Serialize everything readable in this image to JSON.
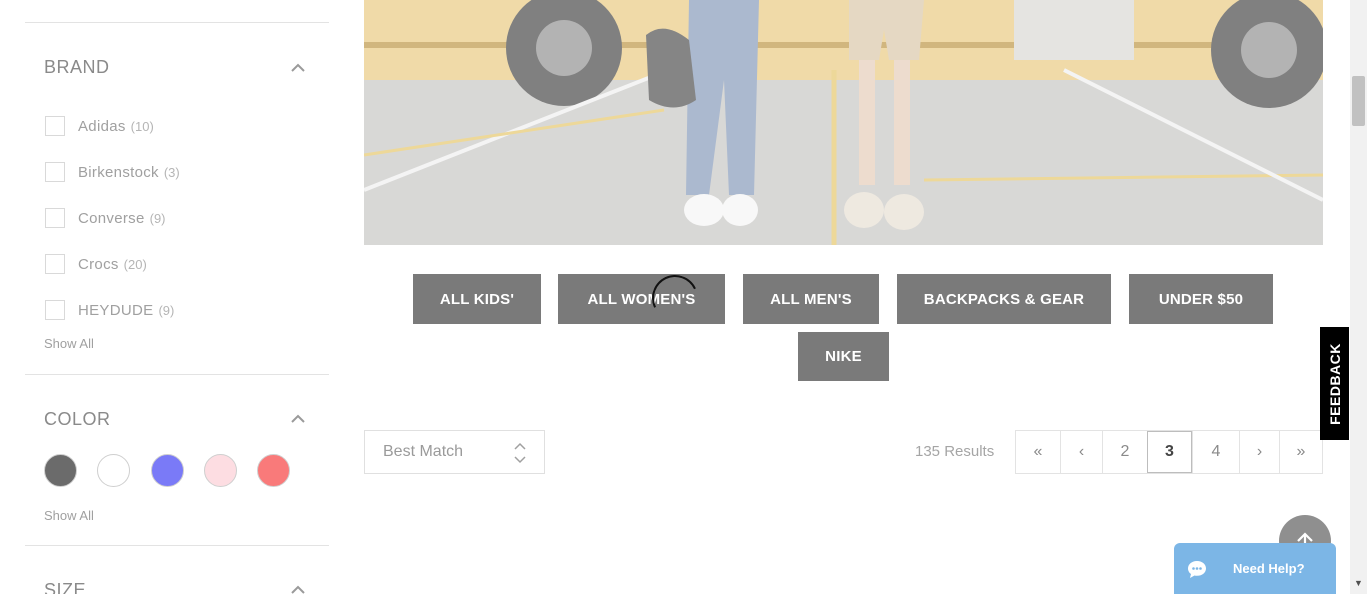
{
  "sidebar": {
    "brand": {
      "title": "BRAND",
      "items": [
        {
          "label": "Adidas",
          "count": "(10)"
        },
        {
          "label": "Birkenstock",
          "count": "(3)"
        },
        {
          "label": "Converse",
          "count": "(9)"
        },
        {
          "label": "Crocs",
          "count": "(20)"
        },
        {
          "label": "HEYDUDE",
          "count": "(9)"
        }
      ],
      "show_all": "Show All"
    },
    "color": {
      "title": "COLOR",
      "swatches": [
        "#6b6b6b",
        "#ffffff",
        "#7a7af7",
        "#fddde2",
        "#f97a7a"
      ],
      "show_all": "Show All"
    },
    "size": {
      "title": "SIZE"
    }
  },
  "categories": [
    "ALL KIDS'",
    "ALL WOMEN'S",
    "ALL MEN'S",
    "BACKPACKS & GEAR",
    "UNDER $50",
    "NIKE"
  ],
  "sort": {
    "label": "Best Match"
  },
  "results": {
    "label": "135 Results"
  },
  "pagination": {
    "pages": [
      "«",
      "‹",
      "2",
      "3",
      "4",
      "›",
      "»"
    ],
    "active": "3"
  },
  "feedback": {
    "label": "FEEDBACK"
  },
  "help": {
    "label": "Need Help?"
  },
  "colors": {
    "button_bg": "#7a7a7a",
    "help_bg": "#7cb6e6",
    "feedback_bg": "#000000"
  }
}
